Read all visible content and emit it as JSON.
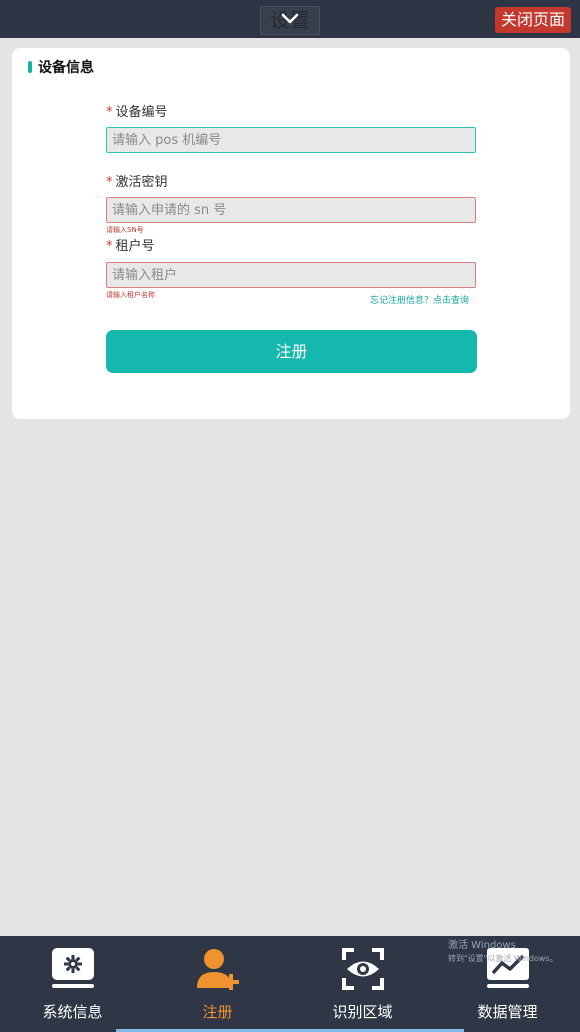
{
  "header": {
    "title": "设置",
    "close_label": "关闭页面"
  },
  "card": {
    "title": "设备信息",
    "fields": [
      {
        "label": "设备编号",
        "required_mark": "*",
        "placeholder": "请输入 pos 机编号",
        "value": "",
        "error": ""
      },
      {
        "label": "激活密钥",
        "required_mark": "*",
        "placeholder": "请输入申请的 sn 号",
        "value": "",
        "error": "请输入SN号"
      },
      {
        "label": "租户号",
        "required_mark": "*",
        "placeholder": "请输入租户",
        "value": "",
        "error": "请输入租户名称"
      }
    ],
    "forgot_link": "忘记注册信息？点击查询",
    "submit_label": "注册"
  },
  "bottom_nav": {
    "items": [
      {
        "label": "系统信息",
        "icon": "gear-monitor-icon",
        "active": false
      },
      {
        "label": "注册",
        "icon": "add-user-icon",
        "active": true
      },
      {
        "label": "识别区域",
        "icon": "eye-scan-icon",
        "active": false
      },
      {
        "label": "数据管理",
        "icon": "chart-monitor-icon",
        "active": false
      }
    ]
  },
  "watermark": {
    "line1": "激活 Windows",
    "line2": "转到\"设置\"以激活 Windows。"
  },
  "colors": {
    "accent": "#14b8ad",
    "active_nav": "#f0932f",
    "danger": "#c4392e",
    "nav_bg": "#2f3747"
  }
}
